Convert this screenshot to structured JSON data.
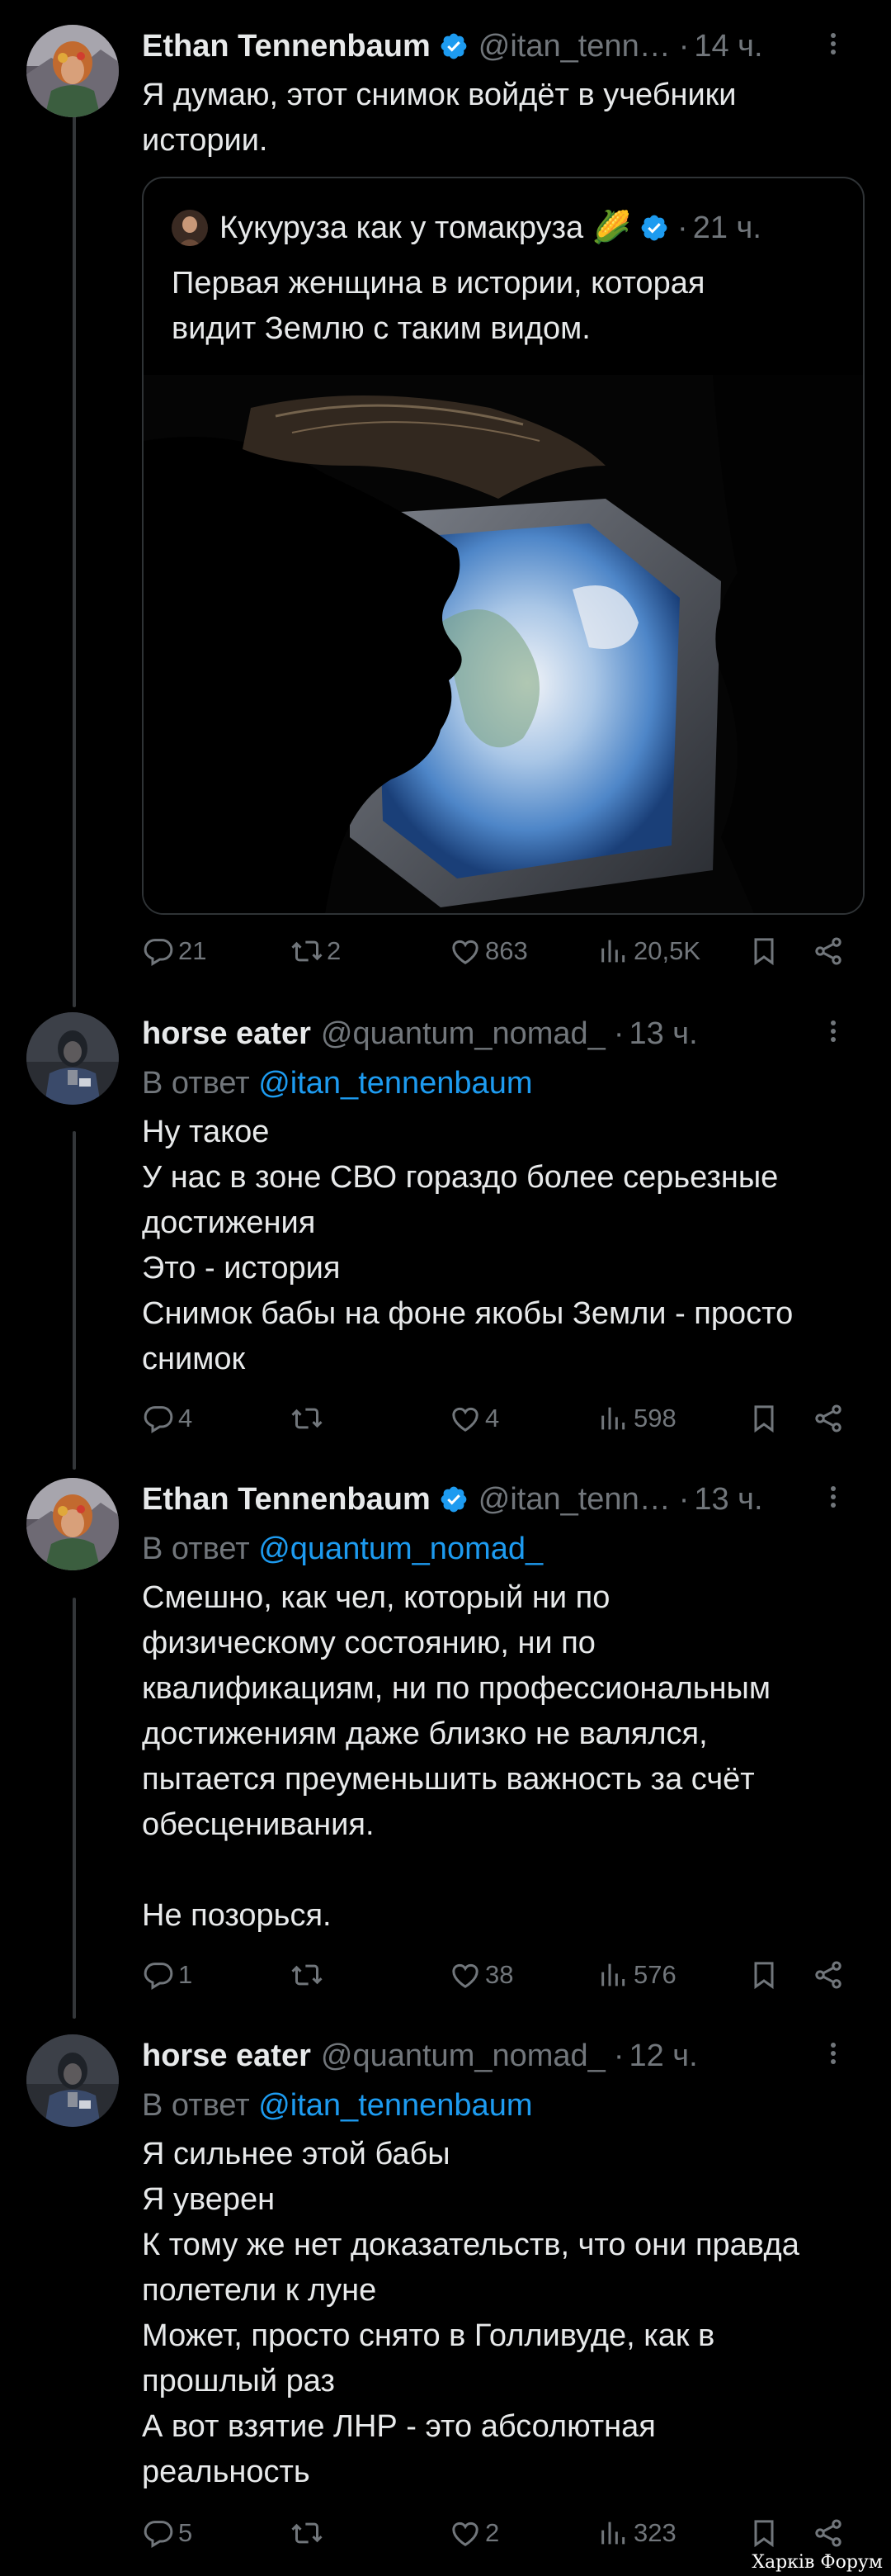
{
  "colors": {
    "background": "#000000",
    "text": "#e7e9ea",
    "secondary": "#71767b",
    "link": "#1d9bf0",
    "verified": "#1d9bf0",
    "border": "#2f3336"
  },
  "tweets": [
    {
      "name": "Ethan Tennenbaum",
      "verified": true,
      "handle": "@itan_tenn…",
      "time": "14 ч.",
      "text_lines": [
        "Я думаю, этот снимок войдёт в учебники",
        "истории."
      ],
      "quote": {
        "name": "Кукуруза как у томакруза 🌽",
        "verified": true,
        "time": "21 ч.",
        "text_lines": [
          "Первая женщина в истории, которая",
          "видит Землю с таким видом."
        ],
        "image": "silhouette-earth-window-photo"
      },
      "stats": {
        "replies": "21",
        "retweets": "2",
        "likes": "863",
        "views": "20,5K"
      }
    },
    {
      "name": "horse eater",
      "verified": false,
      "handle": "@quantum_nomad_",
      "time": "13 ч.",
      "reply_prefix": "В ответ",
      "reply_to": "@itan_tennenbaum",
      "text_lines": [
        "Ну такое",
        "У нас в зоне СВО гораздо более серьезные",
        "достижения",
        "Это - история",
        "Снимок бабы на фоне якобы Земли - просто",
        "снимок"
      ],
      "stats": {
        "replies": "4",
        "retweets": "",
        "likes": "4",
        "views": "598"
      }
    },
    {
      "name": "Ethan Tennenbaum",
      "verified": true,
      "handle": "@itan_tenn…",
      "time": "13 ч.",
      "reply_prefix": "В ответ",
      "reply_to": "@quantum_nomad_",
      "text_lines": [
        "Смешно, как чел, который ни по",
        "физическому состоянию, ни по",
        "квалификациям, ни по профессиональным",
        "достижениям даже близко не валялся,",
        "пытается преуменьшить важность за счёт",
        "обесценивания.",
        "",
        "Не позорься."
      ],
      "stats": {
        "replies": "1",
        "retweets": "",
        "likes": "38",
        "views": "576"
      }
    },
    {
      "name": "horse eater",
      "verified": false,
      "handle": "@quantum_nomad_",
      "time": "12 ч.",
      "reply_prefix": "В ответ",
      "reply_to": "@itan_tennenbaum",
      "text_lines": [
        "Я сильнее этой бабы",
        "Я уверен",
        "К тому же нет доказательств, что они правда",
        "полетели к луне",
        "Может, просто снято в Голливуде, как в",
        "прошлый раз",
        "А вот взятие ЛНР - это абсолютная",
        "реальность"
      ],
      "stats": {
        "replies": "5",
        "retweets": "",
        "likes": "2",
        "views": "323"
      }
    }
  ],
  "watermark": "Харків Форум"
}
